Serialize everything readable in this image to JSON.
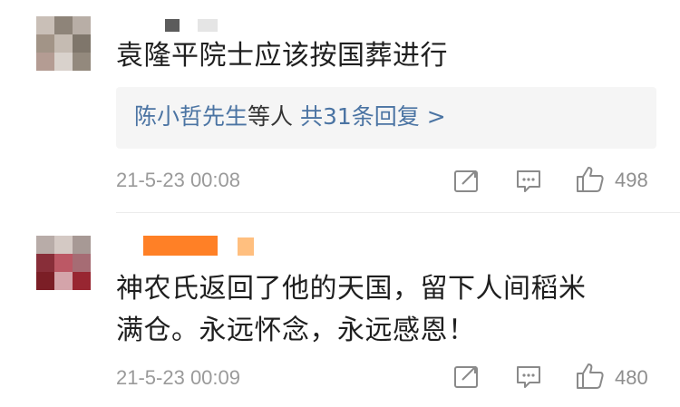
{
  "comments": [
    {
      "text": "袁隆平院士应该按国葬进行",
      "reply": {
        "user": "陈小哲先生",
        "middle": "等人",
        "count_label": "共31条回复 >"
      },
      "time": "21-5-23 00:08",
      "likes": "498",
      "avatar_colors": [
        "#c9bfb7",
        "#8e8478",
        "#b8aea6",
        "#a39486",
        "#c5bbb1",
        "#7f766a",
        "#b59c92",
        "#d9d2cc",
        "#93897c"
      ],
      "name_blur_colors": [
        "#5c5c5c",
        "#e5e5e5"
      ]
    },
    {
      "text_line1": "神农氏返回了他的天国，留下人间稻米",
      "text_line2": "满仓。永远怀念，永远感恩！",
      "time": "21-5-23 00:09",
      "likes": "480",
      "avatar_colors": [
        "#b9aca8",
        "#d4c9c4",
        "#a89995",
        "#8c2d39",
        "#c05765",
        "#a86b74",
        "#7f1d25",
        "#d6a3aa",
        "#9d2530"
      ],
      "name_blur_colors": [
        "#ff6a00",
        "#ffbf7f"
      ]
    }
  ],
  "icons": {
    "share": "share-icon",
    "comment": "comment-icon",
    "like": "thumbs-up-icon"
  }
}
